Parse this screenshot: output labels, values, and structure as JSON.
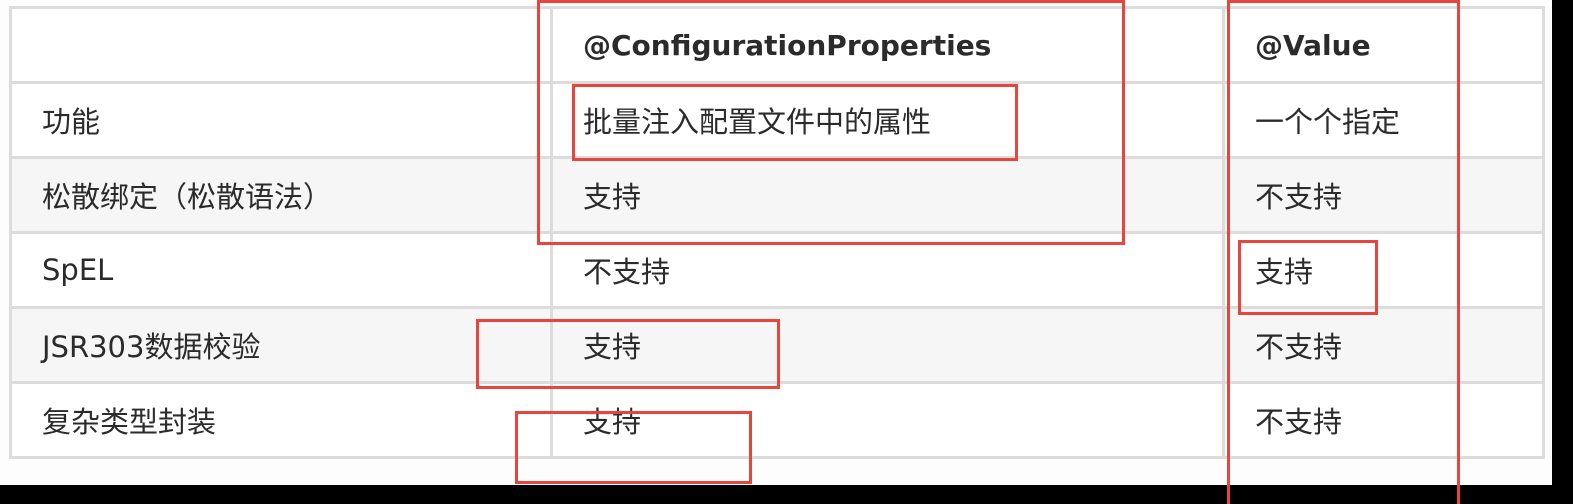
{
  "table": {
    "headers": [
      "",
      "@ConfigurationProperties",
      "@Value"
    ],
    "rows": [
      {
        "feature": "功能",
        "config_properties": "批量注入配置文件中的属性",
        "value": "一个个指定"
      },
      {
        "feature": "松散绑定（松散语法）",
        "config_properties": "支持",
        "value": "不支持"
      },
      {
        "feature": "SpEL",
        "config_properties": "不支持",
        "value": "支持"
      },
      {
        "feature": "JSR303数据校验",
        "config_properties": "支持",
        "value": "不支持"
      },
      {
        "feature": "复杂类型封装",
        "config_properties": "支持",
        "value": "不支持"
      }
    ]
  },
  "colors": {
    "highlight": "#e8463c",
    "border": "#dcdcdc",
    "background": "#000000"
  }
}
